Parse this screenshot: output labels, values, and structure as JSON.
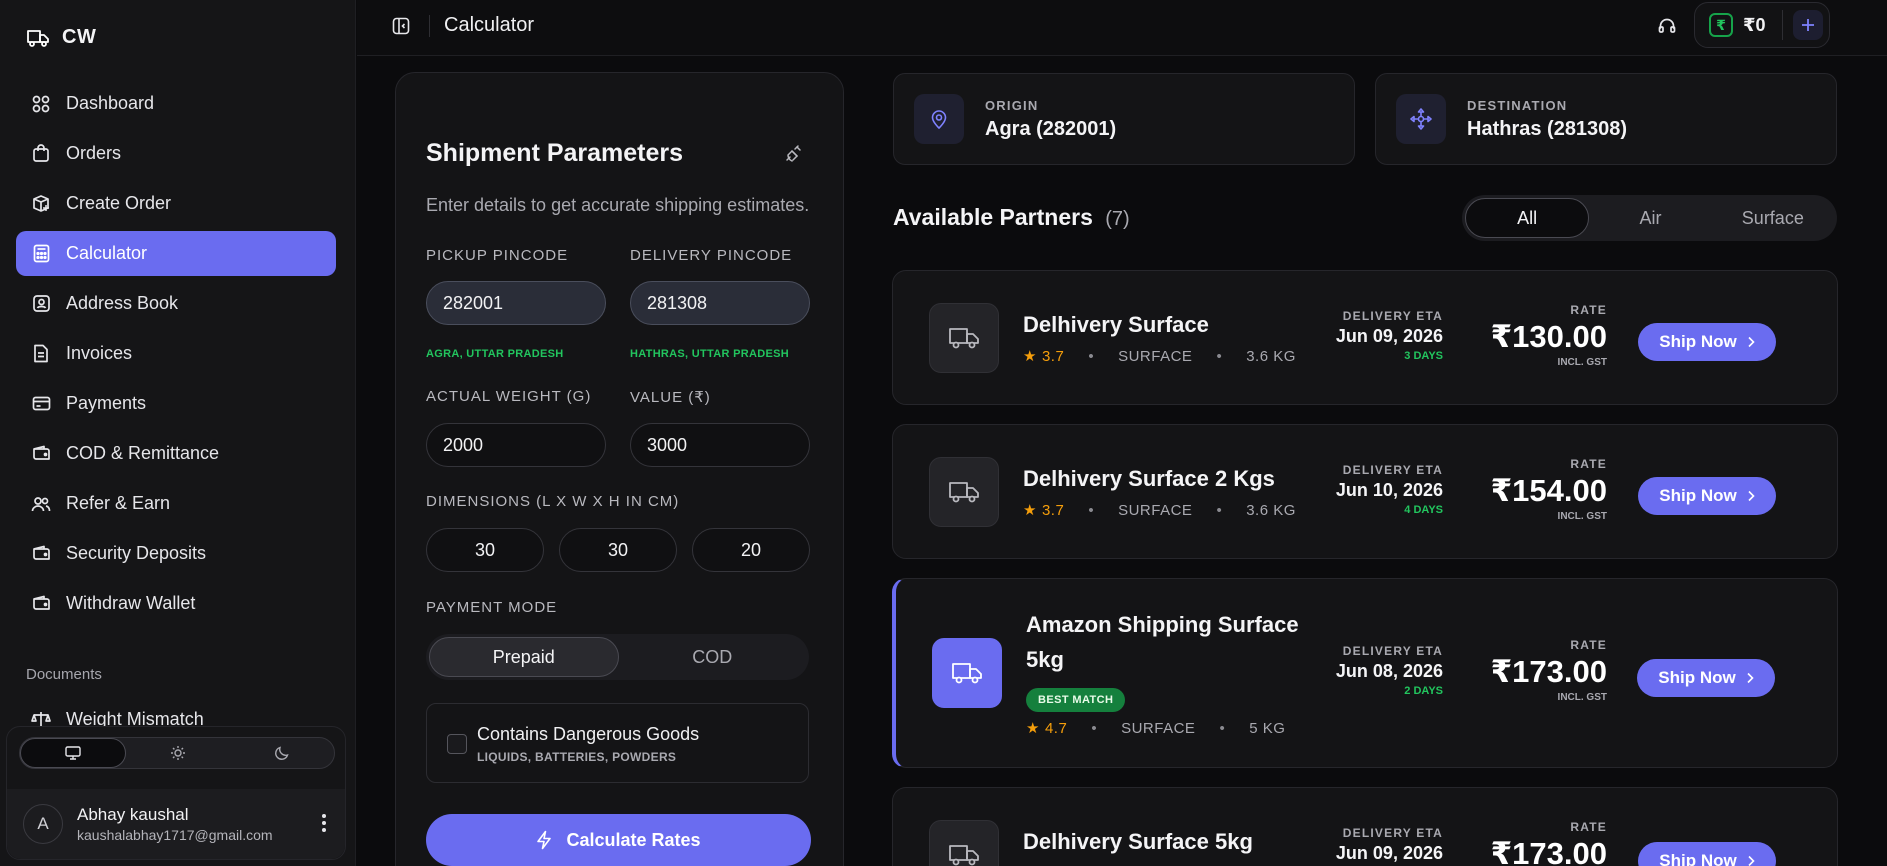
{
  "brand": {
    "name": "CW"
  },
  "sidebar": {
    "items": [
      {
        "label": "Dashboard",
        "icon": "dashboard-icon"
      },
      {
        "label": "Orders",
        "icon": "shopping-bag-icon"
      },
      {
        "label": "Create Order",
        "icon": "box-plus-icon"
      },
      {
        "label": "Calculator",
        "icon": "calculator-icon",
        "active": true
      },
      {
        "label": "Address Book",
        "icon": "address-book-icon"
      },
      {
        "label": "Invoices",
        "icon": "invoice-icon"
      },
      {
        "label": "Payments",
        "icon": "card-icon"
      },
      {
        "label": "COD & Remittance",
        "icon": "wallet-icon"
      },
      {
        "label": "Refer & Earn",
        "icon": "users-icon"
      },
      {
        "label": "Security Deposits",
        "icon": "wallet-icon"
      },
      {
        "label": "Withdraw Wallet",
        "icon": "wallet-icon"
      }
    ],
    "section_label": "Documents",
    "doc_items": [
      {
        "label": "Weight Mismatch",
        "icon": "scale-icon"
      }
    ]
  },
  "user": {
    "initial": "A",
    "name": "Abhay kaushal",
    "email": "kaushalabhay1717@gmail.com"
  },
  "topbar": {
    "title": "Calculator",
    "wallet_amount": "₹0",
    "wallet_symbol": "₹"
  },
  "params": {
    "title": "Shipment Parameters",
    "subtitle": "Enter details to get accurate shipping estimates.",
    "pickup_label": "PICKUP PINCODE",
    "delivery_label": "DELIVERY PINCODE",
    "pickup_value": "282001",
    "delivery_value": "281308",
    "pickup_hint": "AGRA, UTTAR PRADESH",
    "delivery_hint": "HATHRAS, UTTAR PRADESH",
    "weight_label": "ACTUAL WEIGHT (G)",
    "value_label": "VALUE (₹)",
    "weight_value": "2000",
    "value_value": "3000",
    "dims_label": "DIMENSIONS (L X W X H IN CM)",
    "length": "30",
    "width": "30",
    "height": "20",
    "payment_label": "PAYMENT MODE",
    "payment_options": [
      "Prepaid",
      "COD"
    ],
    "payment_selected": "Prepaid",
    "dangerous_title": "Contains Dangerous Goods",
    "dangerous_sub": "LIQUIDS, BATTERIES, POWDERS",
    "dangerous_checked": false,
    "calculate_label": "Calculate Rates"
  },
  "route": {
    "origin_label": "ORIGIN",
    "origin_value": "Agra (282001)",
    "destination_label": "DESTINATION",
    "destination_value": "Hathras (281308)"
  },
  "partners": {
    "title": "Available Partners",
    "count": "(7)",
    "filters": [
      "All",
      "Air",
      "Surface"
    ],
    "filter_selected": "All",
    "eta_label": "DELIVERY ETA",
    "rate_label": "RATE",
    "gst_label": "INCL. GST",
    "ship_label": "Ship Now",
    "cards": [
      {
        "name": "Delhivery Surface",
        "rating": "3.7",
        "mode": "SURFACE",
        "weight": "3.6 KG",
        "eta": "Jun 09, 2026",
        "days": "3 DAYS",
        "rate": "₹130.00"
      },
      {
        "name": "Delhivery Surface 2 Kgs",
        "rating": "3.7",
        "mode": "SURFACE",
        "weight": "3.6 KG",
        "eta": "Jun 10, 2026",
        "days": "4 DAYS",
        "rate": "₹154.00"
      },
      {
        "name_line1": "Amazon Shipping Surface",
        "name_line2": "5kg",
        "badge": "BEST MATCH",
        "rating": "4.7",
        "mode": "SURFACE",
        "weight": "5 KG",
        "eta": "Jun 08, 2026",
        "days": "2 DAYS",
        "rate": "₹173.00"
      },
      {
        "name": "Delhivery Surface 5kg",
        "eta": "Jun 09, 2026",
        "rate": "₹173.00"
      }
    ]
  },
  "colors": {
    "accent": "#6a6cf0",
    "success": "#22c55e",
    "rating": "#f59e0b",
    "background": "#0b0b0d",
    "panel": "#141416"
  }
}
